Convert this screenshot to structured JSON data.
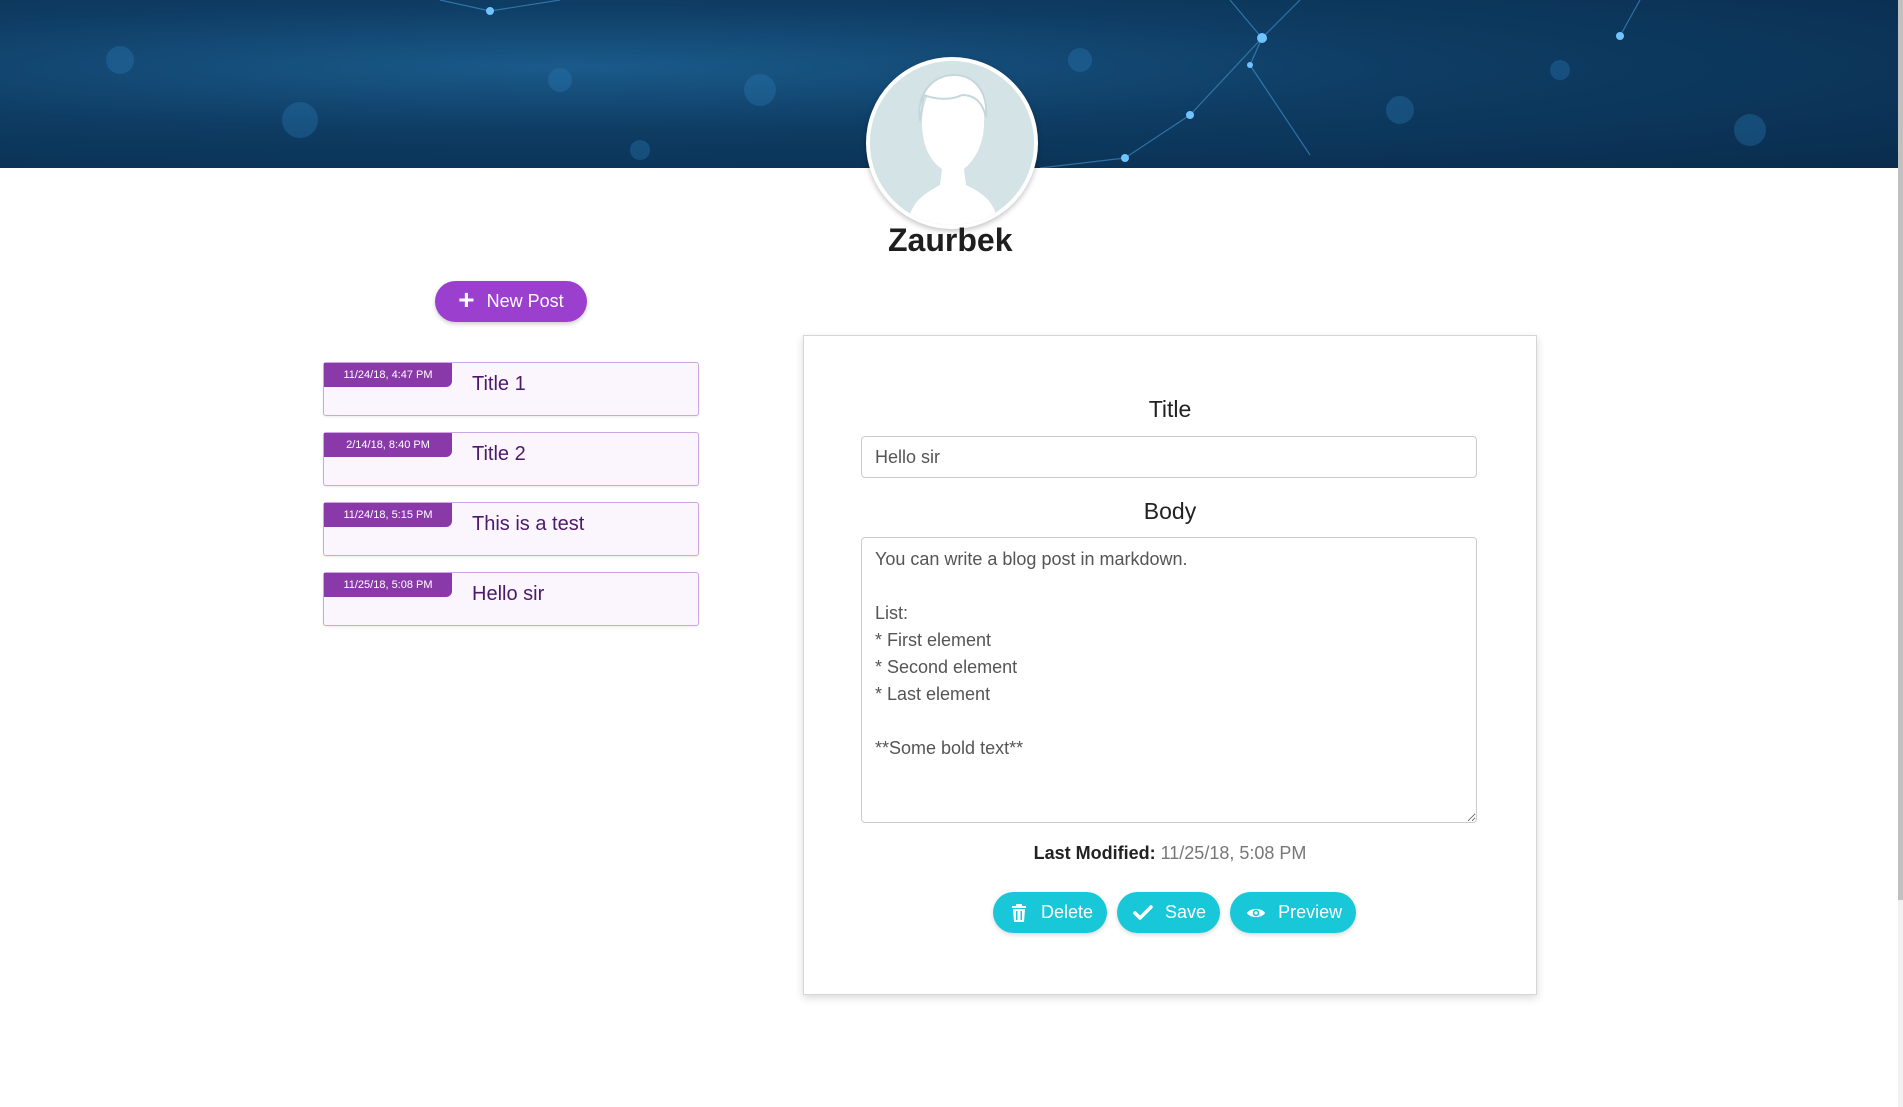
{
  "profile": {
    "username": "Zaurbek"
  },
  "sidebar": {
    "new_post_label": "New Post",
    "posts": [
      {
        "date": "11/24/18, 4:47 PM",
        "title": "Title 1"
      },
      {
        "date": "2/14/18, 8:40 PM",
        "title": "Title 2"
      },
      {
        "date": "11/24/18, 5:15 PM",
        "title": "This is a test"
      },
      {
        "date": "11/25/18, 5:08 PM",
        "title": "Hello sir"
      }
    ]
  },
  "editor": {
    "title_label": "Title",
    "title_value": "Hello sir",
    "body_label": "Body",
    "body_value": "You can write a blog post in markdown.\n\nList:\n* First element\n* Second element\n* Last element\n\n**Some bold text**",
    "last_modified_label": "Last Modified:",
    "last_modified_value": "11/25/18, 5:08 PM",
    "delete_label": "Delete",
    "save_label": "Save",
    "preview_label": "Preview"
  },
  "icons": {
    "new_post": "plus-icon",
    "delete": "trash-icon",
    "save": "check-icon",
    "preview": "eye-icon",
    "avatar": "user-silhouette-icon"
  },
  "colors": {
    "purple_accent": "#9b3fcf",
    "date_badge": "#8a3aa8",
    "cyan_accent": "#18c8d8",
    "banner": "#0e3c63"
  }
}
